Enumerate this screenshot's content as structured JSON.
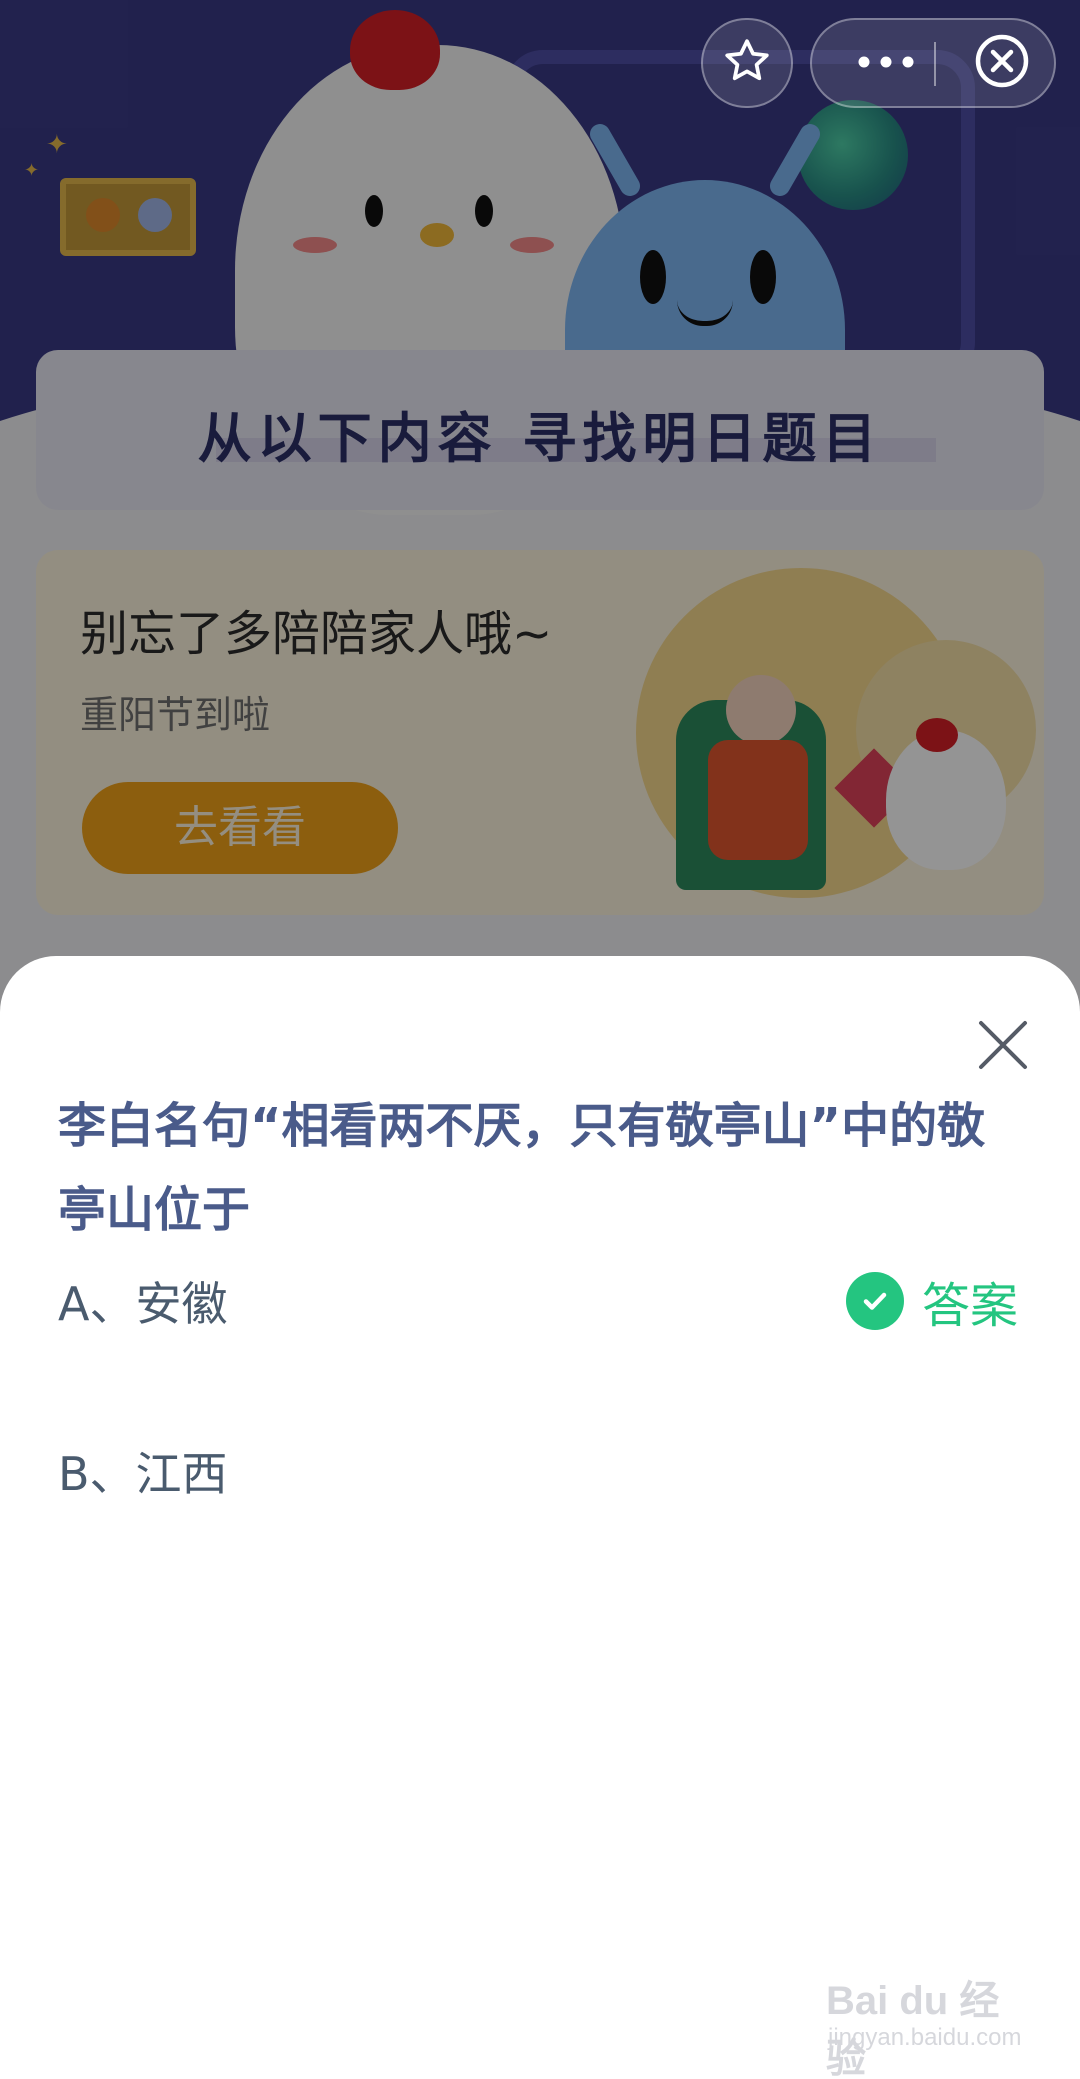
{
  "background": {
    "banner_title": "从以下内容  寻找明日题目",
    "promo": {
      "title": "别忘了多陪陪家人哦~",
      "subtitle": "重阳节到啦",
      "button_label": "去看看"
    }
  },
  "capsule": {
    "favorite_icon": "star-icon",
    "more_icon": "more-dots-icon",
    "exit_icon": "close-circle-icon"
  },
  "quiz": {
    "question": "李白名句“相看两不厌，只有敬亭山”中的敬亭山位于",
    "options": [
      {
        "label": "A、安徽",
        "is_answer": true
      },
      {
        "label": "B、江西",
        "is_answer": false
      }
    ],
    "answer_label": "答案",
    "close_icon": "close-icon"
  },
  "colors": {
    "question_text": "#4a5b8a",
    "answer_green": "#24c580",
    "promo_button": "#f2a319",
    "hero_bg": "#3a3a86"
  },
  "watermark": {
    "logo": "Bai du 经验",
    "url": "jingyan.baidu.com"
  }
}
